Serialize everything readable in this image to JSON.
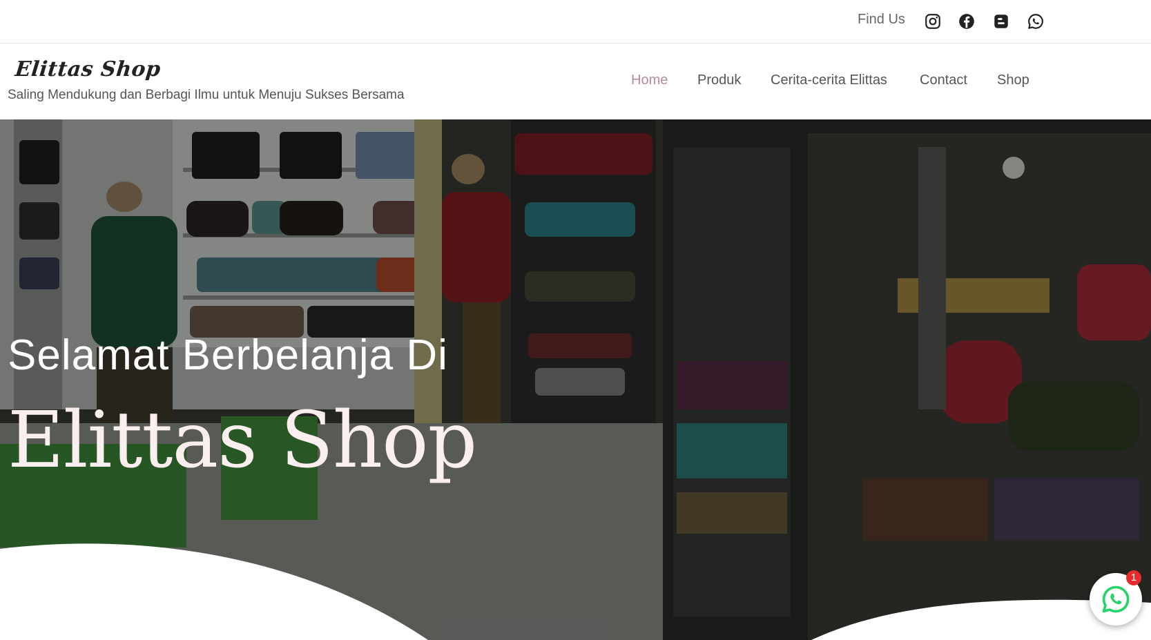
{
  "topbar": {
    "find_us": "Find Us",
    "socials": [
      {
        "name": "instagram-icon"
      },
      {
        "name": "facebook-icon"
      },
      {
        "name": "blogger-icon"
      },
      {
        "name": "whatsapp-icon"
      }
    ]
  },
  "header": {
    "logo": "Elittas Shop",
    "tagline": "Saling Mendukung dan Berbagi Ilmu untuk Menuju Sukses Bersama"
  },
  "nav": {
    "items": [
      {
        "label": "Home",
        "active": true
      },
      {
        "label": "Produk",
        "active": false
      },
      {
        "label": "Cerita-cerita Elittas",
        "active": false
      },
      {
        "label": "Contact",
        "active": false
      },
      {
        "label": "Shop",
        "active": false
      }
    ]
  },
  "hero": {
    "subtitle": "Selamat Berbelanja Di",
    "title": "Elittas Shop"
  },
  "whatsapp_float": {
    "badge": "1"
  },
  "colors": {
    "nav_active": "#b98b96",
    "hero_title": "#fbeeee",
    "whatsapp_green": "#25d366",
    "badge_red": "#e52b2b"
  }
}
